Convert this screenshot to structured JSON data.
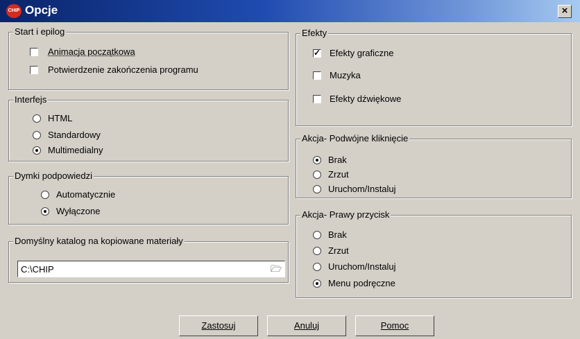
{
  "window": {
    "title": "Opcje",
    "close_label": "×",
    "app_icon_text": "CHIP"
  },
  "groups": {
    "start": {
      "title": "Start i epilog",
      "items": [
        {
          "label": "Animacja początkowa",
          "checked": false
        },
        {
          "label": "Potwierdzenie zakończenia programu",
          "checked": false
        }
      ]
    },
    "interfejs": {
      "title": "Interfejs",
      "items": [
        {
          "label": "HTML",
          "selected": false
        },
        {
          "label": "Standardowy",
          "selected": false
        },
        {
          "label": "Multimedialny",
          "selected": true
        }
      ]
    },
    "dymki": {
      "title": "Dymki podpowiedzi",
      "items": [
        {
          "label": "Automatycznie",
          "selected": false
        },
        {
          "label": "Wyłączone",
          "selected": true
        }
      ]
    },
    "katalog": {
      "title": "Domyślny katalog na kopiowane materiały",
      "value": "C:\\CHIP"
    },
    "efekty": {
      "title": "Efekty",
      "items": [
        {
          "label": "Efekty graficzne",
          "checked": true
        },
        {
          "label": "Muzyka",
          "checked": false
        },
        {
          "label": "Efekty dźwiękowe",
          "checked": false
        }
      ]
    },
    "dwuklik": {
      "title": "Akcja- Podwójne kliknięcie",
      "items": [
        {
          "label": "Brak",
          "selected": true
        },
        {
          "label": "Zrzut",
          "selected": false
        },
        {
          "label": "Uruchom/Instaluj",
          "selected": false
        }
      ]
    },
    "prawy": {
      "title": "Akcja- Prawy przycisk",
      "items": [
        {
          "label": "Brak",
          "selected": false
        },
        {
          "label": "Zrzut",
          "selected": false
        },
        {
          "label": "Uruchom/Instaluj",
          "selected": false
        },
        {
          "label": "Menu podręczne",
          "selected": true
        }
      ]
    }
  },
  "buttons": {
    "apply": "Zastosuj",
    "cancel": "Anuluj",
    "help": "Pomoc"
  }
}
